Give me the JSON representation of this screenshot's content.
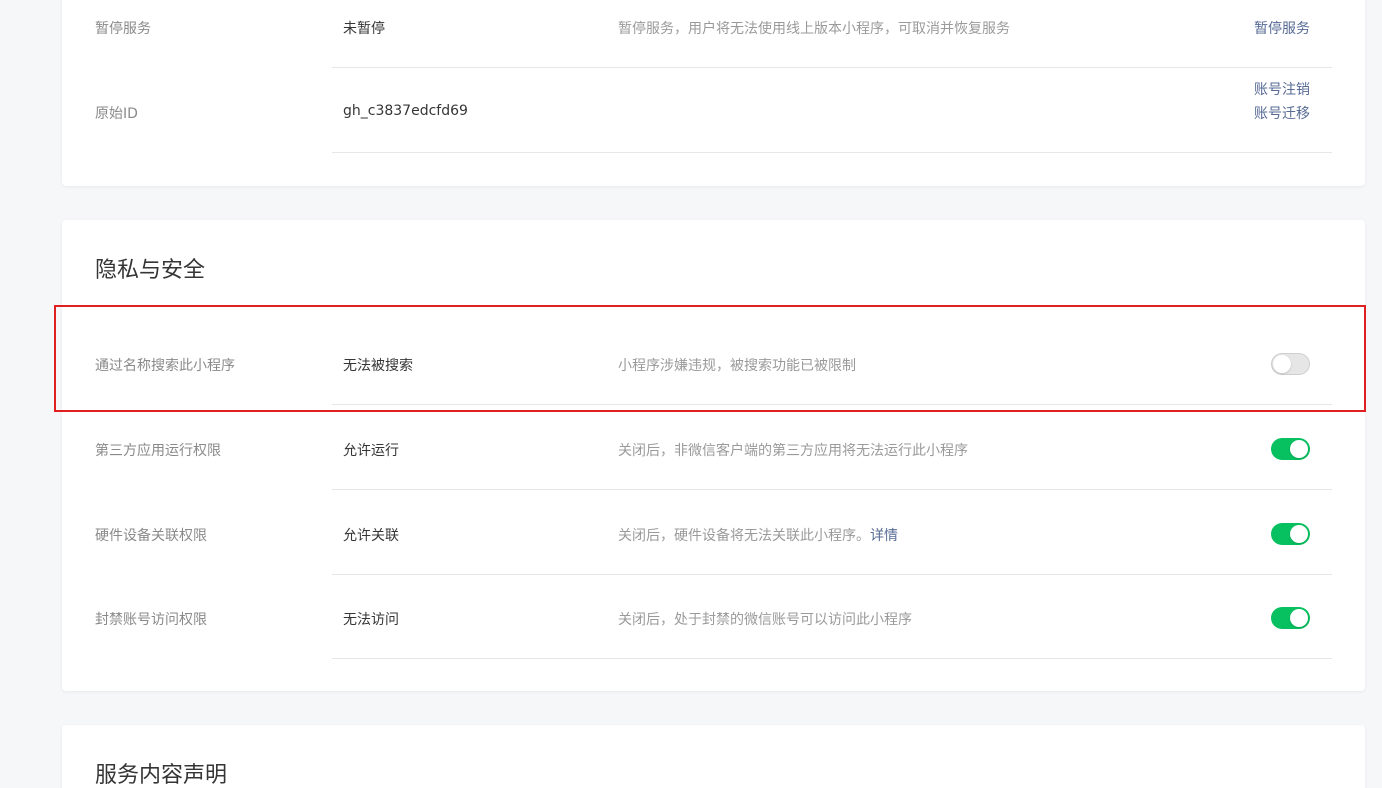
{
  "account_card": {
    "rows": [
      {
        "label": "暂停服务",
        "value": "未暂停",
        "desc": "暂停服务，用户将无法使用线上版本小程序，可取消并恢复服务",
        "action": "暂停服务"
      },
      {
        "label": "原始ID",
        "value": "gh_c3837edcfd69",
        "actions": [
          "账号注销",
          "账号迁移"
        ]
      }
    ]
  },
  "privacy_card": {
    "title": "隐私与安全",
    "rows": [
      {
        "label": "通过名称搜索此小程序",
        "value": "无法被搜索",
        "desc": "小程序涉嫌违规，被搜索功能已被限制",
        "toggle": "off"
      },
      {
        "label": "第三方应用运行权限",
        "value": "允许运行",
        "desc": "关闭后，非微信客户端的第三方应用将无法运行此小程序",
        "toggle": "on"
      },
      {
        "label": "硬件设备关联权限",
        "value": "允许关联",
        "desc": "关闭后，硬件设备将无法关联此小程序。",
        "desc_link": "详情",
        "toggle": "on"
      },
      {
        "label": "封禁账号访问权限",
        "value": "无法访问",
        "desc": "关闭后，处于封禁的微信账号可以访问此小程序",
        "toggle": "on"
      }
    ]
  },
  "service_card": {
    "title": "服务内容声明"
  },
  "colors": {
    "background": "#f6f7f9",
    "link": "#576b95",
    "toggle_on": "#07c160",
    "toggle_off": "#cfcfcf",
    "highlight": "#e02020"
  },
  "icons": [
    "toggle-switch"
  ]
}
